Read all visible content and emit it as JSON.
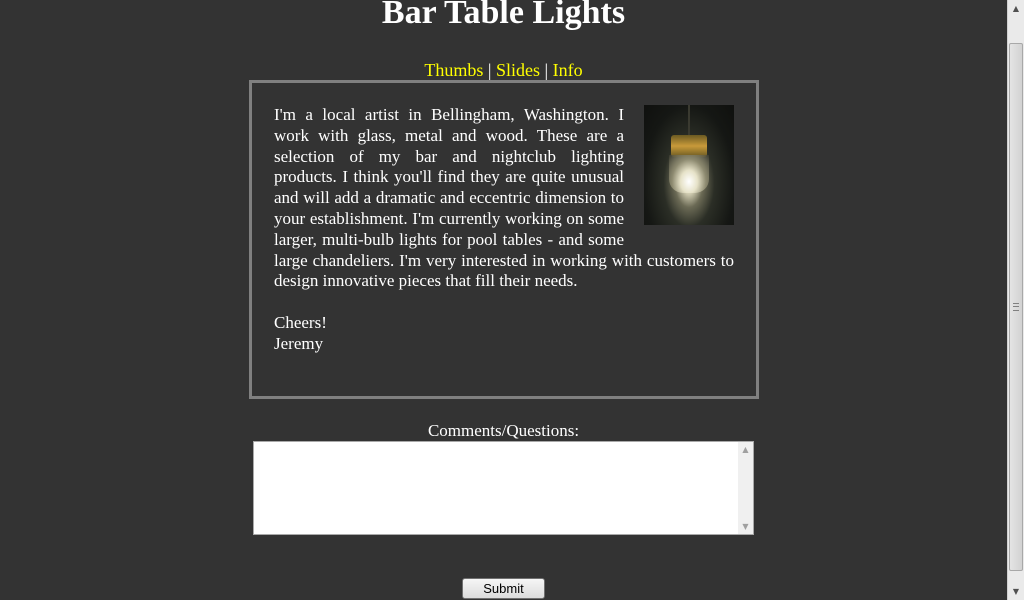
{
  "page": {
    "title": "Bar Table Lights"
  },
  "nav": {
    "thumbs": "Thumbs",
    "slides": "Slides",
    "info": "Info",
    "separator": "|"
  },
  "info": {
    "photo_icon": "pendant-lamp-photo",
    "paragraph": "I'm a local artist in Bellingham, Washington. I work with glass, metal and wood. These are a selection of my bar and nightclub lighting products. I think you'll find they are quite unusual and will add a dramatic and eccentric dimension to your establishment. I'm currently working on some larger, multi-bulb lights for pool tables - and some large chandeliers. I'm very interested in working with customers to design innovative pieces that fill their needs.",
    "closing": "Cheers!",
    "signature": "Jeremy"
  },
  "comments": {
    "label": "Comments/Questions:",
    "value": "",
    "scroll_up_icon": "arrow-up-icon",
    "scroll_down_icon": "arrow-down-icon"
  },
  "form": {
    "submit_label": "Submit"
  },
  "colors": {
    "background": "#333333",
    "nav_link": "#ffff00",
    "box_border": "#808080",
    "text": "#ffffff"
  }
}
